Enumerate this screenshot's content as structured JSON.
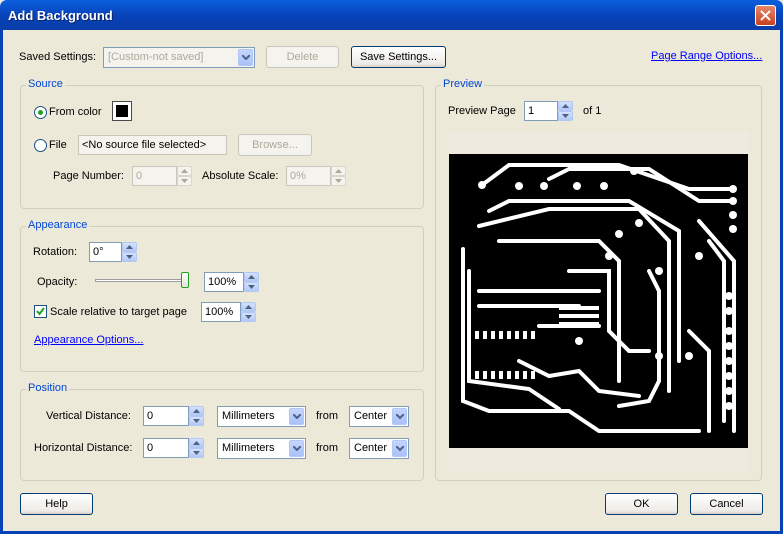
{
  "window": {
    "title": "Add Background"
  },
  "saved_settings": {
    "label": "Saved Settings:",
    "value": "[Custom-not saved]",
    "delete_label": "Delete",
    "save_label": "Save Settings...",
    "page_range_link": "Page Range Options..."
  },
  "source": {
    "title": "Source",
    "from_color_label": "From color",
    "file_label": "File",
    "file_value": "<No source file selected>",
    "browse_label": "Browse...",
    "page_number_label": "Page Number:",
    "page_number_value": "0",
    "absolute_scale_label": "Absolute Scale:",
    "absolute_scale_value": "0%",
    "color_swatch": "#000000"
  },
  "appearance": {
    "title": "Appearance",
    "rotation_label": "Rotation:",
    "rotation_value": "0°",
    "opacity_label": "Opacity:",
    "opacity_value": "100%",
    "opacity_fraction": 1.0,
    "scale_label": "Scale relative to target page",
    "scale_value": "100%",
    "options_link": "Appearance Options..."
  },
  "position": {
    "title": "Position",
    "vertical_label": "Vertical Distance:",
    "vertical_value": "0",
    "vertical_unit": "Millimeters",
    "vertical_from_label": "from",
    "vertical_from": "Center",
    "horizontal_label": "Horizontal Distance:",
    "horizontal_value": "0",
    "horizontal_unit": "Millimeters",
    "horizontal_from_label": "from",
    "horizontal_from": "Center"
  },
  "preview": {
    "title": "Preview",
    "page_label": "Preview Page",
    "page_value": "1",
    "of_label": "of 1"
  },
  "footer": {
    "help_label": "Help",
    "ok_label": "OK",
    "cancel_label": "Cancel"
  },
  "colors": {
    "accent": "#0046D5",
    "titlebar": "#0842B8",
    "face": "#ECE9D8"
  }
}
